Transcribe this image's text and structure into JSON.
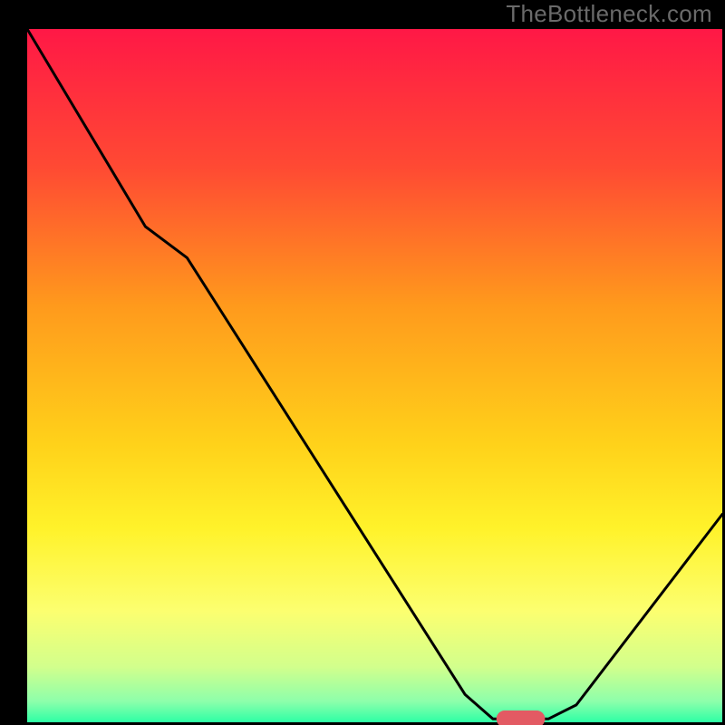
{
  "watermark": "TheBottleneck.com",
  "chart_data": {
    "type": "line",
    "title": "",
    "xlabel": "",
    "ylabel": "",
    "xlim": [
      0,
      100
    ],
    "ylim": [
      0,
      100
    ],
    "frame": {
      "x0": 30,
      "y0": 32,
      "x1": 797,
      "y1": 797
    },
    "gradient_stops": [
      {
        "offset": 0.0,
        "color": "#ff1846"
      },
      {
        "offset": 0.2,
        "color": "#ff4a33"
      },
      {
        "offset": 0.4,
        "color": "#ff9a1c"
      },
      {
        "offset": 0.6,
        "color": "#ffd21a"
      },
      {
        "offset": 0.72,
        "color": "#fff22a"
      },
      {
        "offset": 0.84,
        "color": "#fcff70"
      },
      {
        "offset": 0.92,
        "color": "#d2ff8c"
      },
      {
        "offset": 0.97,
        "color": "#8dffab"
      },
      {
        "offset": 1.0,
        "color": "#2dffa5"
      }
    ],
    "curve": [
      {
        "x": 0.0,
        "y": 100.0
      },
      {
        "x": 17.0,
        "y": 71.5
      },
      {
        "x": 23.0,
        "y": 67.0
      },
      {
        "x": 63.0,
        "y": 4.0
      },
      {
        "x": 67.0,
        "y": 0.5
      },
      {
        "x": 75.0,
        "y": 0.5
      },
      {
        "x": 79.0,
        "y": 2.5
      },
      {
        "x": 100.0,
        "y": 30.0
      }
    ],
    "marker": {
      "x": 71.0,
      "y": 0.5,
      "rx": 3.5,
      "ry": 1.2,
      "color": "#e35a63"
    }
  }
}
